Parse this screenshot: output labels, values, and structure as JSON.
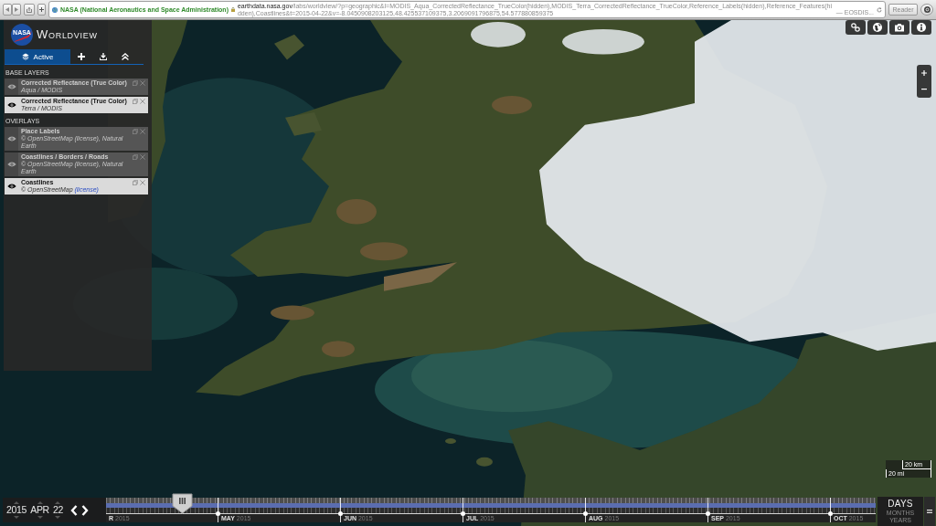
{
  "browser": {
    "site_name": "NASA (National Aeronautics and Space Administration)",
    "domain": "earthdata.nasa.gov",
    "path": "/labs/worldview/?p=geographic&l=MODIS_Aqua_CorrectedReflectance_TrueColor(hidden),MODIS_Terra_CorrectedReflectance_TrueColor,Reference_Labels(hidden),Reference_Features(hidden),Coastlines&t=2015-04-22&v=-8.0450908203125,48.425537109375,3.2069091796875,54.577880859375",
    "page_title": "— EOSDIS...",
    "reader_button": "Reader"
  },
  "app": {
    "logo_text": "NASA",
    "title": "WORLDVIEW"
  },
  "panel": {
    "tabs": [
      {
        "label": "Active",
        "selected": true
      }
    ],
    "sections": [
      {
        "heading": "BASE LAYERS",
        "layers": [
          {
            "title": "Corrected Reflectance (True Color)",
            "subtitle": "Aqua / MODIS",
            "visible": false
          },
          {
            "title": "Corrected Reflectance (True Color)",
            "subtitle": "Terra / MODIS",
            "visible": true
          }
        ]
      },
      {
        "heading": "OVERLAYS",
        "layers": [
          {
            "title": "Place Labels",
            "subtitle": "© OpenStreetMap ",
            "link": "(license)",
            "subtitle_end": ", Natural Earth",
            "visible": false
          },
          {
            "title": "Coastlines / Borders / Roads",
            "subtitle": "© OpenStreetMap ",
            "link": "(license)",
            "subtitle_end": ", Natural Earth",
            "visible": false
          },
          {
            "title": "Coastlines",
            "subtitle": "© OpenStreetMap ",
            "link": "(license)",
            "visible": true
          }
        ]
      }
    ]
  },
  "scale": {
    "top_label": "20 km",
    "bottom_label": "20 mi"
  },
  "timeline": {
    "date": {
      "year": "2015",
      "month": "APR",
      "day": "22"
    },
    "level": 0.099,
    "months": [
      {
        "month": "R",
        "year": "2015"
      },
      {
        "month": "MAY",
        "year": "2015"
      },
      {
        "month": "JUN",
        "year": "2015"
      },
      {
        "month": "JUL",
        "year": "2015"
      },
      {
        "month": "AUG",
        "year": "2015"
      },
      {
        "month": "SEP",
        "year": "2015"
      },
      {
        "month": "OCT",
        "year": "2015"
      }
    ],
    "zoom_levels": [
      {
        "label": "DAYS",
        "selected": true
      },
      {
        "label": "MONTHS",
        "selected": false
      },
      {
        "label": "YEARS",
        "selected": false
      }
    ]
  }
}
